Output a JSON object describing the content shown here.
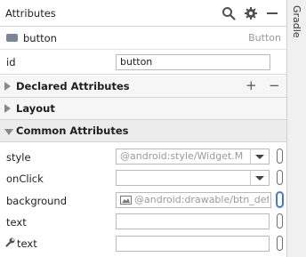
{
  "header": {
    "title": "Attributes"
  },
  "side_tab": {
    "label": "Gradle"
  },
  "component": {
    "name": "button",
    "type": "Button"
  },
  "id_field": {
    "label": "id",
    "value": "button"
  },
  "sections": {
    "declared": "Declared Attributes",
    "layout": "Layout",
    "common": "Common Attributes"
  },
  "attributes": {
    "style": {
      "label": "style",
      "value": "@android:style/Widget.M"
    },
    "onclick": {
      "label": "onClick",
      "value": ""
    },
    "background": {
      "label": "background",
      "value": "@android:drawable/btn_defa"
    },
    "text": {
      "label": "text",
      "value": ""
    },
    "tools_text": {
      "label": "text",
      "value": ""
    }
  },
  "colors": {
    "focus": "#4c8ad8",
    "section_bg": "#ececec",
    "placeholder": "#9a9a9a"
  }
}
